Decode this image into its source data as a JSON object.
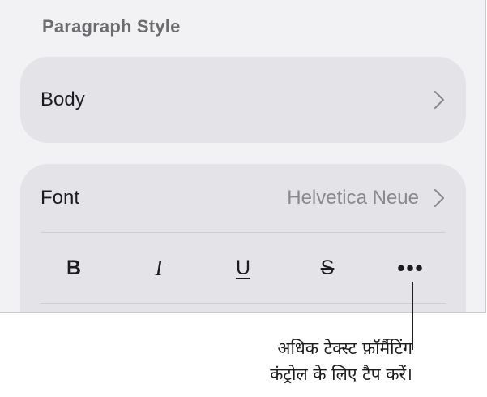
{
  "paragraph_style": {
    "header": "Paragraph Style",
    "selected": "Body"
  },
  "font": {
    "label": "Font",
    "value": "Helvetica Neue"
  },
  "format_buttons": {
    "bold": "B",
    "italic": "I",
    "underline": "U",
    "strikethrough": "S",
    "more": "•••"
  },
  "callout": {
    "line1": "अधिक टेक्स्ट फ़ॉर्मैटिंग",
    "line2": "कंट्रोल के लिए टैप करें।"
  },
  "icons": {
    "chevron": "chevron-right-icon",
    "more": "ellipsis-icon"
  },
  "colors": {
    "panel_bg": "#f2f2f4",
    "card_bg": "#e4e4e8",
    "header_text": "#6b6b70",
    "value_text": "#8a8a8e",
    "label_text": "#1c1c1e"
  }
}
